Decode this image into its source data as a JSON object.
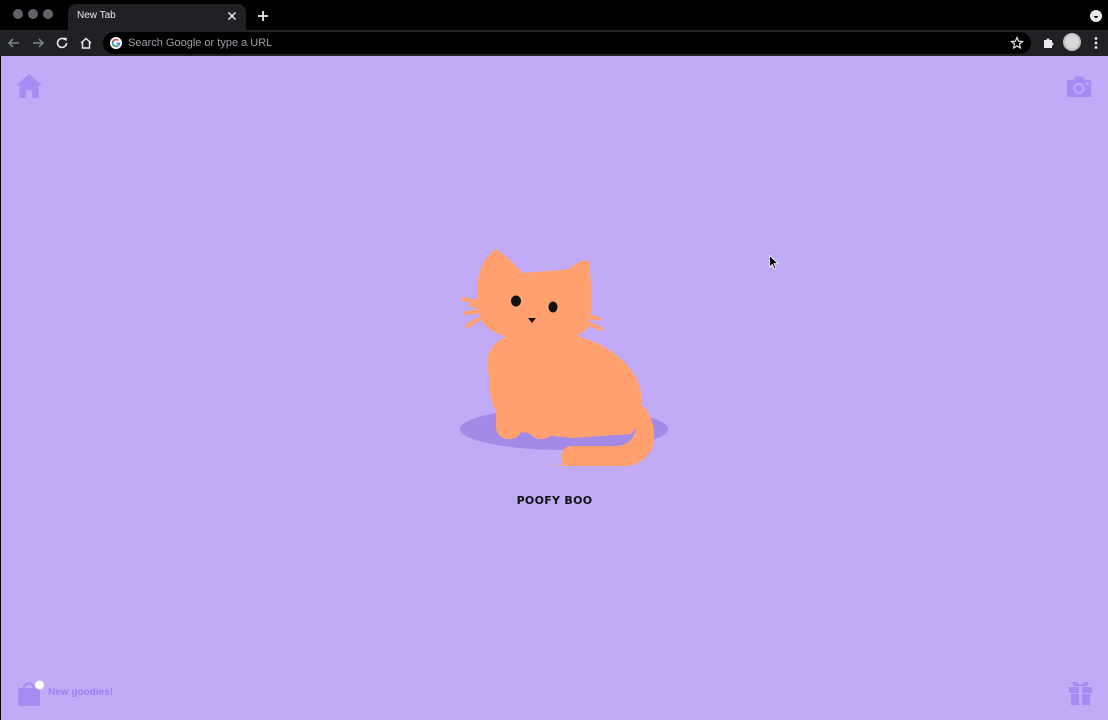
{
  "browser": {
    "tab_title": "New Tab",
    "omnibox_placeholder": "Search Google or type a URL"
  },
  "page": {
    "pet_name": "POOFY BOO",
    "goodies_label": "New goodies!",
    "colors": {
      "background": "#c1aaf6",
      "icon": "#a68bf2",
      "cat": "#ffa06e",
      "shadow": "#a48ae8"
    },
    "icons": {
      "top_left": "home-icon",
      "top_right": "camera-icon",
      "bottom_left": "shopping-bag-icon",
      "bottom_right": "gift-icon"
    }
  }
}
